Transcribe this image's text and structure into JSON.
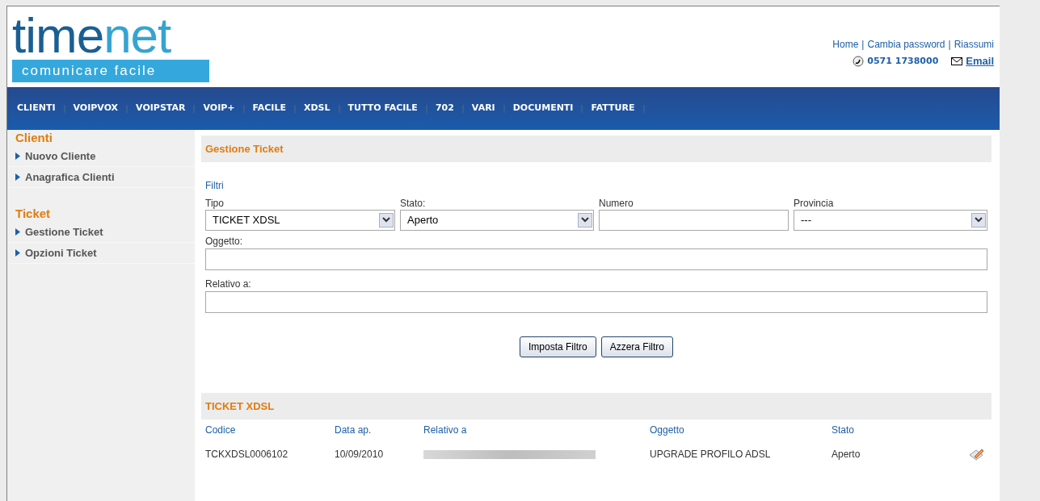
{
  "logo": {
    "name_dark": "time",
    "name_light": "net",
    "tagline": "comunicare facile"
  },
  "top_links": [
    "Home",
    "Cambia password",
    "Riassumi"
  ],
  "top_separator": "|",
  "contact": {
    "phone": "0571 1738000",
    "email": "Email"
  },
  "nav": [
    "CLIENTI",
    "VOIPVOX",
    "VOIPSTAR",
    "VOIP+",
    "FACILE",
    "XDSL",
    "TUTTO FACILE",
    "702",
    "VARI",
    "DOCUMENTI",
    "FATTURE"
  ],
  "sidebar": [
    {
      "title": "Clienti",
      "items": [
        "Nuovo Cliente",
        "Anagrafica Clienti"
      ]
    },
    {
      "title": "Ticket",
      "items": [
        "Gestione Ticket",
        "Opzioni Ticket"
      ]
    }
  ],
  "page_title": "Gestione Ticket",
  "filters": {
    "title": "Filtri",
    "row": [
      {
        "kind": "select",
        "label": "Tipo",
        "value": "TICKET XDSL"
      },
      {
        "kind": "select",
        "label": "Stato:",
        "value": "Aperto"
      },
      {
        "kind": "text",
        "label": "Numero"
      },
      {
        "kind": "select",
        "label": "Provincia",
        "value": "---"
      }
    ],
    "oggetto_label": "Oggetto:",
    "relativo_label": "Relativo a:",
    "buttons": [
      "Imposta Filtro",
      "Azzera Filtro"
    ]
  },
  "table": {
    "title": "TICKET XDSL",
    "columns": [
      "Codice",
      "Data ap.",
      "Relativo a",
      "Oggetto",
      "Stato"
    ],
    "rows": [
      {
        "codice": "TCKXDSL0006102",
        "data": "10/09/2010",
        "oggetto": "UPGRADE PROFILO ADSL",
        "stato": "Aperto"
      }
    ]
  }
}
